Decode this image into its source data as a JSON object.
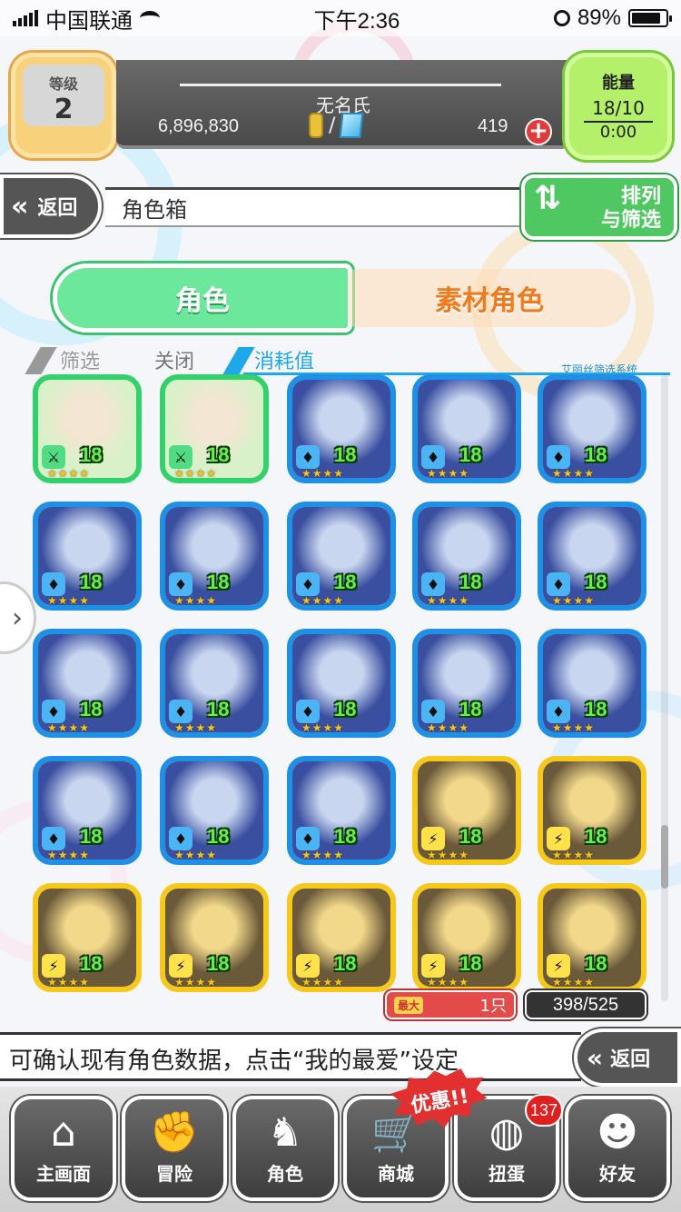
{
  "status_bar": {
    "carrier": "中国联通",
    "time": "下午2:36",
    "battery": "89%"
  },
  "header": {
    "level_label": "等级",
    "level": "2",
    "player_name": "无名氏",
    "gold": "6,896,830",
    "slash": "/",
    "gems": "419",
    "add_symbol": "+",
    "energy_label": "能量",
    "energy": "18/10",
    "energy_timer": "0:00"
  },
  "titlebar": {
    "back_label": "返回",
    "title": "角色箱",
    "sort_label_1": "排列",
    "sort_label_2": "与筛选"
  },
  "tabs": {
    "characters": "角色",
    "materials": "素材角色"
  },
  "filter": {
    "filter_label": "筛选",
    "close_label": "关闭",
    "cost_label": "消耗值",
    "system_note": "艾丽丝筛选系统"
  },
  "grid": {
    "cards": [
      {
        "element": "wood",
        "level": "18",
        "frame": "green"
      },
      {
        "element": "wood",
        "level": "18",
        "frame": "green"
      },
      {
        "element": "water",
        "level": "18",
        "frame": "blue"
      },
      {
        "element": "water",
        "level": "18",
        "frame": "blue"
      },
      {
        "element": "water",
        "level": "18",
        "frame": "blue"
      },
      {
        "element": "water",
        "level": "18",
        "frame": "blue"
      },
      {
        "element": "water",
        "level": "18",
        "frame": "blue"
      },
      {
        "element": "water",
        "level": "18",
        "frame": "blue"
      },
      {
        "element": "water",
        "level": "18",
        "frame": "blue"
      },
      {
        "element": "water",
        "level": "18",
        "frame": "blue"
      },
      {
        "element": "water",
        "level": "18",
        "frame": "blue"
      },
      {
        "element": "water",
        "level": "18",
        "frame": "blue"
      },
      {
        "element": "water",
        "level": "18",
        "frame": "blue"
      },
      {
        "element": "water",
        "level": "18",
        "frame": "blue"
      },
      {
        "element": "water",
        "level": "18",
        "frame": "blue"
      },
      {
        "element": "water",
        "level": "18",
        "frame": "blue"
      },
      {
        "element": "water",
        "level": "18",
        "frame": "blue"
      },
      {
        "element": "water",
        "level": "18",
        "frame": "blue"
      },
      {
        "element": "thunder",
        "level": "18",
        "frame": "yellow"
      },
      {
        "element": "thunder",
        "level": "18",
        "frame": "yellow"
      },
      {
        "element": "thunder",
        "level": "18",
        "frame": "yellow"
      },
      {
        "element": "thunder",
        "level": "18",
        "frame": "yellow"
      },
      {
        "element": "thunder",
        "level": "18",
        "frame": "yellow"
      },
      {
        "element": "thunder",
        "level": "18",
        "frame": "yellow"
      },
      {
        "element": "thunder",
        "level": "18",
        "frame": "yellow"
      }
    ],
    "stars": "★★★★"
  },
  "counts": {
    "max_label": "最大",
    "favorite_count": "1只",
    "box_count": "398/525"
  },
  "message": "可确认现有角色数据，点击“我的最爱”设定",
  "bottom_back_label": "返回",
  "nav": {
    "home": "主画面",
    "adventure": "冒险",
    "characters": "角色",
    "shop": "商城",
    "gacha": "扭蛋",
    "friends": "好友",
    "promo": "优惠!!",
    "gacha_badge": "137"
  },
  "colors": {
    "frame_green": "#33d16b",
    "frame_blue": "#1e90e6",
    "frame_yellow": "#f6c81a",
    "tab_active": "#6ce89c",
    "tab_inactive_text": "#f07a1e",
    "level_text": "#67f04a"
  }
}
